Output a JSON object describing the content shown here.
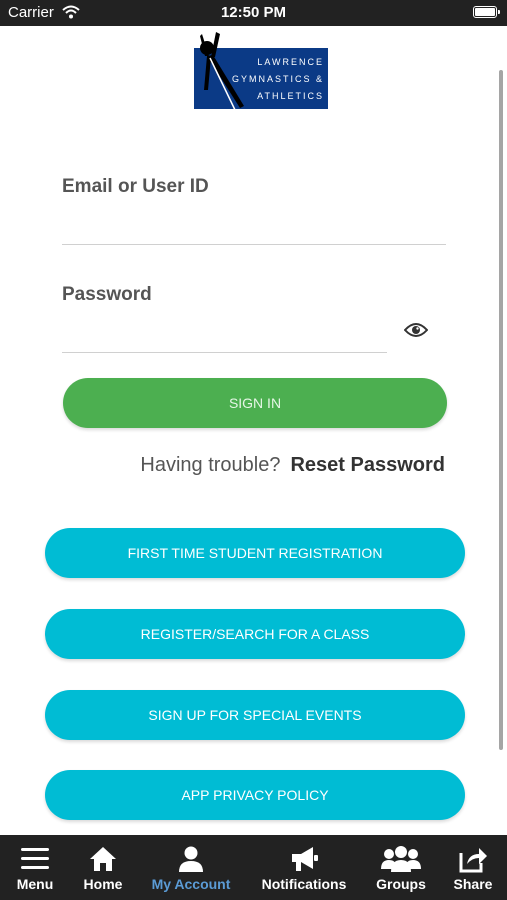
{
  "status_bar": {
    "carrier": "Carrier",
    "time": "12:50 PM"
  },
  "logo": {
    "line1": "LAWRENCE",
    "line2": "GYMNASTICS &",
    "line3": "ATHLETICS"
  },
  "form": {
    "email_label": "Email or User ID",
    "email_value": "",
    "password_label": "Password",
    "password_value": "",
    "signin_label": "SIGN IN",
    "trouble_text": "Having trouble?",
    "reset_label": "Reset Password"
  },
  "actions": [
    {
      "label": "FIRST TIME STUDENT REGISTRATION"
    },
    {
      "label": "REGISTER/SEARCH FOR A CLASS"
    },
    {
      "label": "SIGN UP FOR SPECIAL EVENTS"
    },
    {
      "label": "APP PRIVACY POLICY"
    }
  ],
  "tab_bar": {
    "items": [
      {
        "label": "Menu",
        "icon": "menu-icon"
      },
      {
        "label": "Home",
        "icon": "home-icon"
      },
      {
        "label": "My Account",
        "icon": "user-icon",
        "active": true
      },
      {
        "label": "Notifications",
        "icon": "megaphone-icon"
      },
      {
        "label": "Groups",
        "icon": "groups-icon"
      },
      {
        "label": "Share",
        "icon": "share-icon"
      }
    ]
  },
  "colors": {
    "signin": "#4caf50",
    "action": "#00bcd4",
    "active_tab": "#5b9bd5",
    "tab_bar": "#222222",
    "logo_bg": "#0b3a86"
  }
}
